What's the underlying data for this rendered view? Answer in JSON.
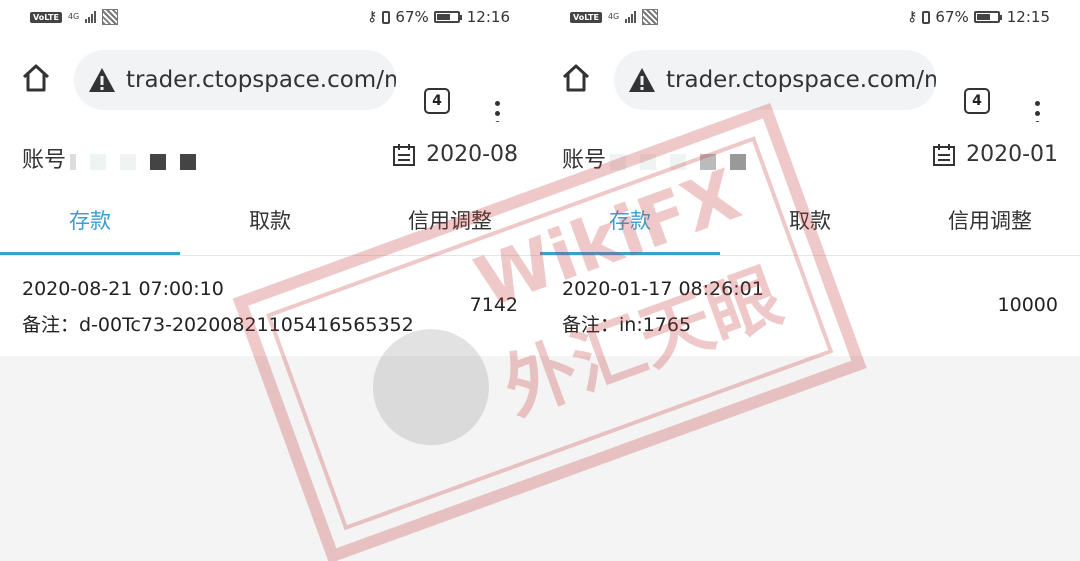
{
  "panels": [
    {
      "status": {
        "volte": "VoLTE",
        "network": "4G",
        "battery": "67%",
        "time": "12:16"
      },
      "url": "trader.ctopspace.com/m",
      "tab_count": "4",
      "account_label": "账号",
      "date": "2020-08",
      "tabs": [
        "存款",
        "取款",
        "信用调整"
      ],
      "active_tab": 0,
      "record": {
        "time": "2020-08-21 07:00:10",
        "note": "备注：d-00Tc73-20200821105416565352",
        "amount": "7142"
      }
    },
    {
      "status": {
        "volte": "VoLTE",
        "network": "4G",
        "battery": "67%",
        "time": "12:15"
      },
      "url": "trader.ctopspace.com/m",
      "tab_count": "4",
      "account_label": "账号",
      "date": "2020-01",
      "tabs": [
        "存款",
        "取款",
        "信用调整"
      ],
      "active_tab": 0,
      "record": {
        "time": "2020-01-17 08:26:01",
        "note": "备注：in:1765",
        "amount": "10000"
      }
    }
  ],
  "watermark": {
    "brand": "WikiFX",
    "stamp_text": "外汇天眼"
  },
  "colors": {
    "accent": "#3b9fd0",
    "watermark": "#c84040"
  }
}
